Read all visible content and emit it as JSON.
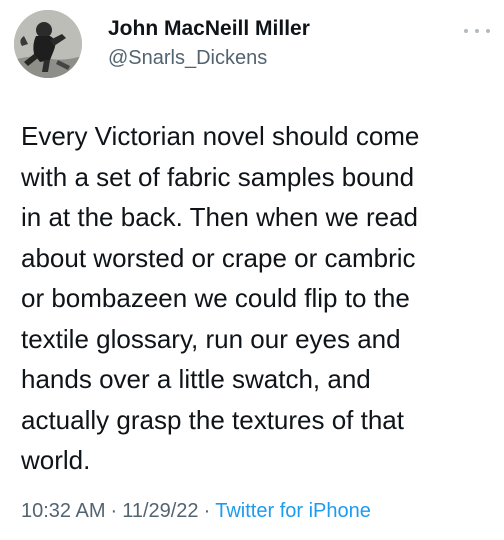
{
  "author": {
    "display_name": "John MacNeill Miller",
    "handle": "@Snarls_Dickens",
    "avatar_icon": "victorian-figure-avatar-icon"
  },
  "more_icon": "more-options-icon",
  "tweet": {
    "lines": [
      "Every Victorian novel should come",
      "with a set of fabric samples bound",
      "in at the back. Then when we read",
      "about worsted or crape or cambric",
      "or bombazeen we could flip to the",
      "textile glossary, run our eyes and",
      "hands over a little swatch, and",
      "actually grasp the textures of that",
      "world."
    ]
  },
  "meta": {
    "time": "10:32 AM",
    "separator": "·",
    "date": "11/29/22",
    "source": "Twitter for iPhone"
  },
  "colors": {
    "text": "#0f1419",
    "secondary": "#536471",
    "link": "#1d9bf0",
    "background": "#ffffff"
  }
}
